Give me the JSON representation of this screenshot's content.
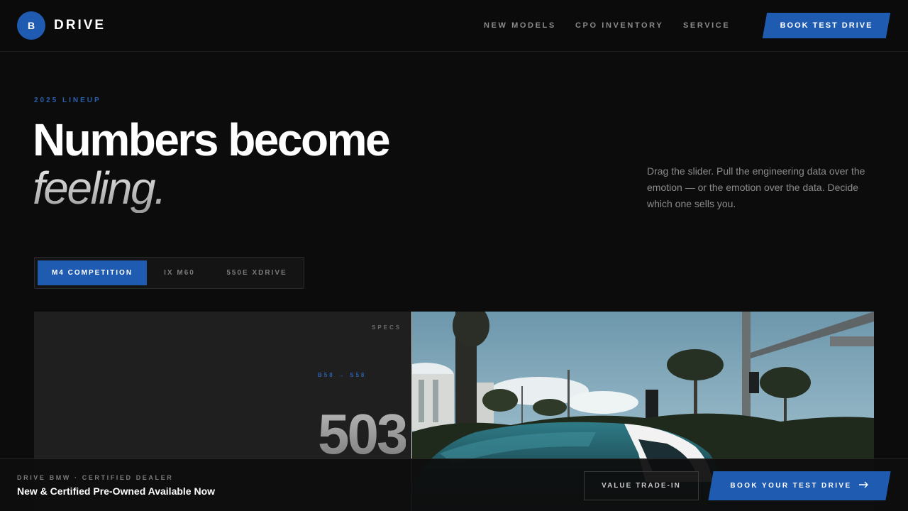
{
  "header": {
    "logo_letter": "B",
    "brand": "DRIVE",
    "nav": [
      "NEW MODELS",
      "CPO INVENTORY",
      "SERVICE"
    ],
    "cta": "BOOK TEST DRIVE"
  },
  "hero": {
    "eyebrow": "2025 LINEUP",
    "title_line1": "Numbers become",
    "title_line2": "feeling.",
    "description": "Drag the slider. Pull the engineering data over the emotion — or the emotion over the data. Decide which one sells you."
  },
  "tabs": {
    "items": [
      "M4 COMPETITION",
      "IX M60",
      "550E XDRIVE"
    ],
    "active": "M4 COMPETITION"
  },
  "compare": {
    "specs_label": "SPECS",
    "range_label": "B58 → S58",
    "big_number": "503"
  },
  "bottom_bar": {
    "eyebrow": "DRIVE BMW · CERTIFIED DEALER",
    "title": "New & Certified Pre-Owned Available Now",
    "secondary_button": "VALUE TRADE-IN",
    "primary_button": "BOOK YOUR TEST DRIVE",
    "primary_icon": "arrow-right-icon"
  },
  "colors": {
    "accent": "#1f5bb0",
    "background": "#0c0c0c"
  }
}
